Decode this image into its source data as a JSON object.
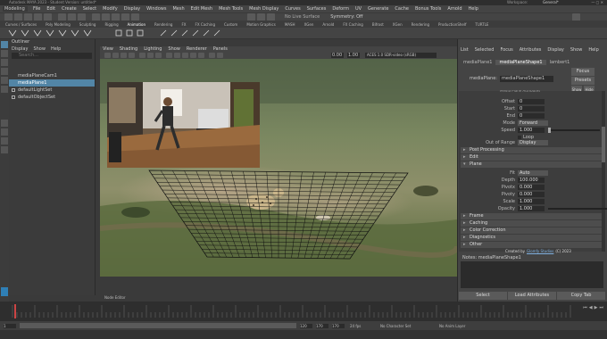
{
  "titlebar": {
    "title": "Autodesk MAYA 2023 - Student Version: untitled*",
    "workspace_label": "Workspace:",
    "workspace_value": "General*"
  },
  "menubar": {
    "mode": "Modeling",
    "items": [
      "File",
      "Edit",
      "Create",
      "Select",
      "Modify",
      "Display",
      "Windows",
      "Mesh",
      "Edit Mesh",
      "Mesh Tools",
      "Mesh Display",
      "Curves",
      "Surfaces",
      "Deform",
      "UV",
      "Generate",
      "Cache",
      "Bonus Tools",
      "Arnold",
      "Help"
    ],
    "live_surface": "No Live Surface",
    "symmetry": "Symmetry: Off"
  },
  "shelf": {
    "tabs": [
      "Curves / Surfaces",
      "Poly Modeling",
      "Sculpting",
      "Rigging",
      "Animation",
      "Rendering",
      "FX",
      "FX Caching",
      "Custom",
      "Motion Graphics",
      "MASH",
      "XGen",
      "Arnold",
      "FX Caching",
      "Bifrost",
      "XGen",
      "Rendering",
      "ProductionShelf",
      "TURTLE"
    ],
    "active_index": 4
  },
  "outliner": {
    "title": "Outliner",
    "menu": [
      "Display",
      "Show",
      "Help"
    ],
    "search_placeholder": "Search...",
    "items": [
      {
        "label": "mediaPlaneCam1",
        "selected": false
      },
      {
        "label": "mediaPlane1",
        "selected": true
      },
      {
        "label": "defaultLightSet",
        "selected": false
      },
      {
        "label": "defaultObjectSet",
        "selected": false
      }
    ]
  },
  "viewport": {
    "menu": [
      "View",
      "Shading",
      "Lighting",
      "Show",
      "Renderer",
      "Panels"
    ],
    "field_a": "0.00",
    "field_b": "1.00",
    "color_space": "ACES 1.0 SDR-video (sRGB)"
  },
  "attribute_editor": {
    "menu": [
      "List",
      "Selected",
      "Focus",
      "Attributes",
      "Display",
      "Show",
      "Help"
    ],
    "tabs": [
      "mediaPlane1",
      "mediaPlaneShape1",
      "lambert1"
    ],
    "active_tab": 1,
    "node_label": "mediaPlane:",
    "node_value": "mediaPlaneShape1",
    "buttons": {
      "focus": "Focus",
      "presets": "Presets",
      "show": "Show",
      "hide": "Hide"
    },
    "clipped_header": "Media Plane Attributes",
    "fields": {
      "offset": {
        "label": "Offset",
        "value": "0"
      },
      "start": {
        "label": "Start",
        "value": "0"
      },
      "end": {
        "label": "End",
        "value": "0"
      },
      "mode": {
        "label": "Mode",
        "value": "Forward"
      },
      "speed": {
        "label": "Speed",
        "value": "1.000"
      },
      "loop": {
        "label": "Loop"
      },
      "out_of_range": {
        "label": "Out of Range",
        "value": "Display"
      }
    },
    "sections": {
      "post_processing": "Post Processing",
      "edit": "Edit",
      "plane": "Plane",
      "frame": "Frame",
      "caching": "Caching",
      "color_correction": "Color Correction",
      "diagnostics": "Diagnostics",
      "other": "Other"
    },
    "plane": {
      "fit": {
        "label": "Fit",
        "value": "Auto"
      },
      "depth": {
        "label": "Depth",
        "value": "100.000"
      },
      "pivot_x": {
        "label": "Pivotx",
        "value": "0.000"
      },
      "pivot_y": {
        "label": "Pivoty",
        "value": "0.000"
      },
      "scale": {
        "label": "Scale",
        "value": "1.000"
      },
      "opacity": {
        "label": "Opacity",
        "value": "1.000"
      }
    },
    "credit": "Created by",
    "credit_author": "Glomfy Studios",
    "credit_year": "(C) 2023",
    "notes_label": "Notes: mediaPlaneShape1",
    "bottom_buttons": [
      "Select",
      "Load Attributes",
      "Copy Tab"
    ]
  },
  "node_editor_tab": "Node Editor",
  "timeline": {
    "start": "1",
    "end": "120",
    "range_start": "1",
    "range_end": "120",
    "playback_end": "170",
    "playback_end2": "170",
    "fps": "24 fps",
    "char_set": "No Character Set",
    "anim_layer": "No Anim Layer"
  },
  "colors": {
    "accent": "#5285a6",
    "panel": "#444444",
    "field": "#2b2b2b"
  }
}
